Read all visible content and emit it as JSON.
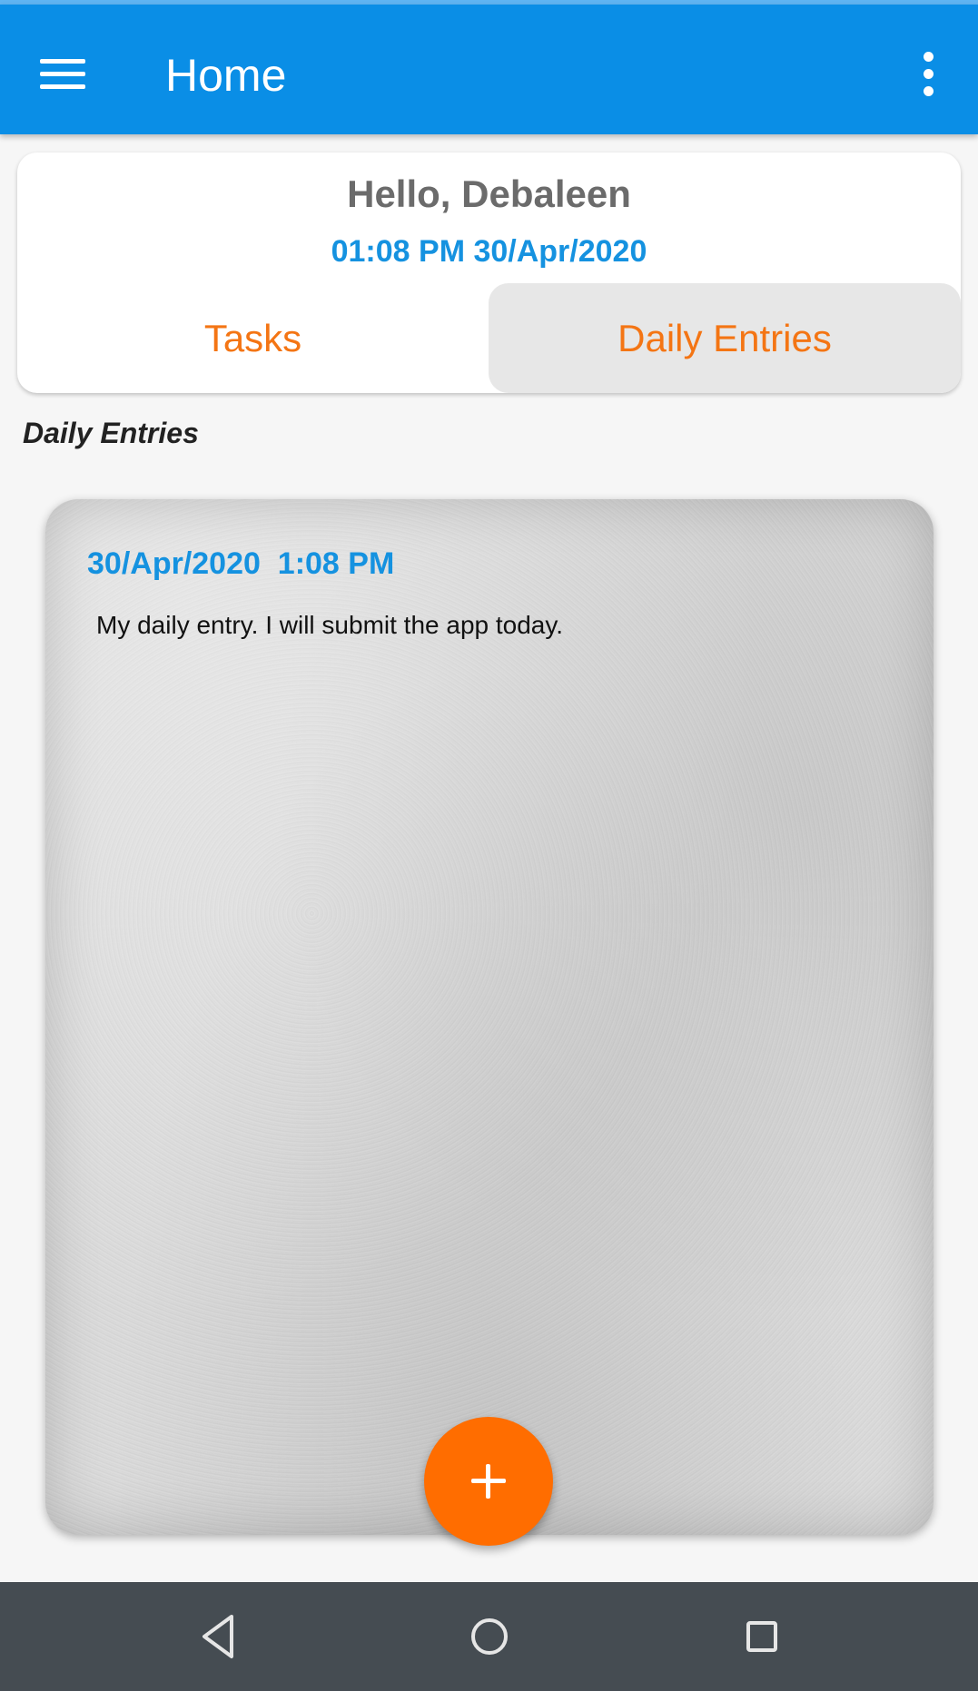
{
  "app_bar": {
    "title": "Home",
    "menu_icon": "hamburger-menu-icon",
    "overflow_icon": "more-vert-icon",
    "background_color": "#0a8ee6"
  },
  "header": {
    "greeting": "Hello, Debaleen",
    "datetime": "01:08 PM 30/Apr/2020",
    "tabs": [
      {
        "label": "Tasks",
        "selected": false
      },
      {
        "label": "Daily Entries",
        "selected": true
      }
    ]
  },
  "section": {
    "title": "Daily Entries"
  },
  "entries": [
    {
      "date": "30/Apr/2020  1:08 PM",
      "text": "My daily entry. I will submit the app today."
    }
  ],
  "fab": {
    "icon": "add-icon",
    "color": "#ff6d00"
  },
  "system_nav": {
    "back_icon": "back-triangle-icon",
    "home_icon": "home-circle-icon",
    "recents_icon": "recents-square-icon"
  },
  "colors": {
    "accent_blue": "#1592e0",
    "accent_orange": "#f47514"
  }
}
